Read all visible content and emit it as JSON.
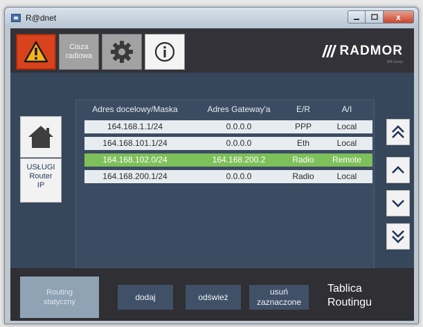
{
  "window": {
    "title": "R@dnet",
    "close_label": "x"
  },
  "toolbar": {
    "quiet_line1": "Cisza",
    "quiet_line2": "radiowa",
    "logo_text": "RADMOR",
    "logo_sub": "WB Group"
  },
  "sidebar": {
    "router_line1": "USŁUGI",
    "router_line2": "Router",
    "router_line3": "IP"
  },
  "table": {
    "columns": [
      "Adres docelowy/Maska",
      "Adres Gateway'a",
      "E/R",
      "A/I"
    ],
    "rows": [
      {
        "dest": "164.168.1.1/24",
        "gateway": "0.0.0.0",
        "er": "PPP",
        "ai": "Local"
      },
      {
        "dest": "164.168.101.1/24",
        "gateway": "0.0.0.0",
        "er": "Eth",
        "ai": "Local"
      },
      {
        "dest": "164.168.102.0/24",
        "gateway": "164.168.200.2",
        "er": "Radio",
        "ai": "Remote"
      },
      {
        "dest": "164.168.200.1/24",
        "gateway": "0.0.0.0",
        "er": "Radio",
        "ai": "Local"
      }
    ],
    "selected_row": 2
  },
  "bottom": {
    "static_line1": "Routing",
    "static_line2": "statyczny",
    "add_label": "dodaj",
    "refresh_label": "odśwież",
    "delete_line1": "usuń",
    "delete_line2": "zaznaczone",
    "title_line1": "Tablica",
    "title_line2": "Routingu"
  },
  "colors": {
    "alarm": "#d8421d",
    "selected_row": "#7ec05a",
    "panel": "#36465b",
    "bar": "#2f2f34"
  },
  "icons": [
    "warning-icon",
    "gear-icon",
    "info-icon",
    "home-icon",
    "page-first-icon",
    "arrow-up-icon",
    "arrow-down-icon",
    "page-last-icon"
  ]
}
